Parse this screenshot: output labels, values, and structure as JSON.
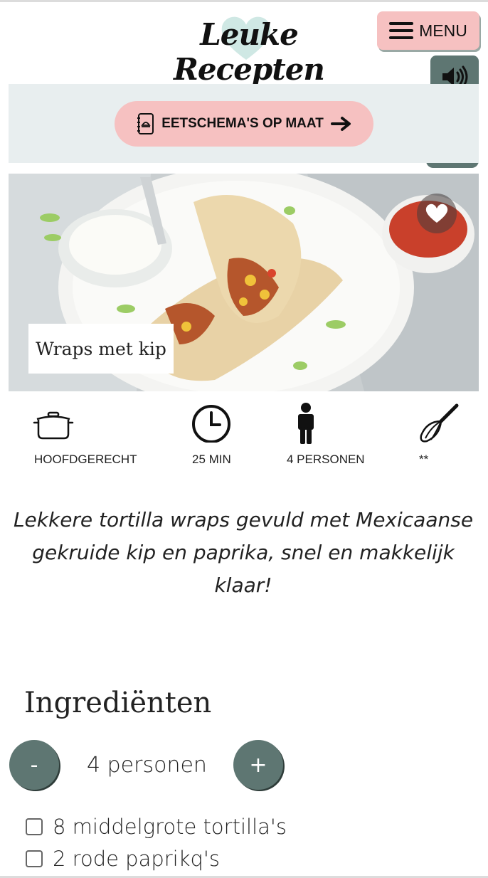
{
  "header": {
    "logo_text": "Leuke Recepten",
    "menu_label": "MENU"
  },
  "icons": {
    "menu": "hamburger-icon",
    "sound": "speaker-icon",
    "seasonal": "christmas-ornament-icon",
    "schedule": "notebook-icon",
    "arrow": "arrow-right-icon",
    "favorite": "heart-icon"
  },
  "banner": {
    "button_label": "EETSCHEMA'S OP MAAT"
  },
  "recipe": {
    "title": "Wraps met kip",
    "meta": [
      {
        "icon": "cooking-pot-icon",
        "label": "HOOFDGERECHT"
      },
      {
        "icon": "clock-icon",
        "label": "25 MIN"
      },
      {
        "icon": "person-icon",
        "label": "4 PERSONEN"
      },
      {
        "icon": "whisk-icon",
        "label": "**"
      }
    ],
    "intro": "Lekkere tortilla wraps gevuld met Mexicaanse gekruide kip en paprika, snel en makkelijk klaar!"
  },
  "ingredients": {
    "heading": "Ingrediënten",
    "decrease_label": "-",
    "increase_label": "+",
    "servings": "4 personen",
    "items": [
      {
        "label": "8 middelgrote tortilla's",
        "checked": false
      },
      {
        "label": "2 rode paprikq's",
        "checked": false
      }
    ]
  },
  "colors": {
    "accent_pink": "#f6c1c1",
    "accent_green": "#5e7672",
    "banner_bg": "#e8eeef",
    "heart_mint": "#cfe8e4"
  }
}
